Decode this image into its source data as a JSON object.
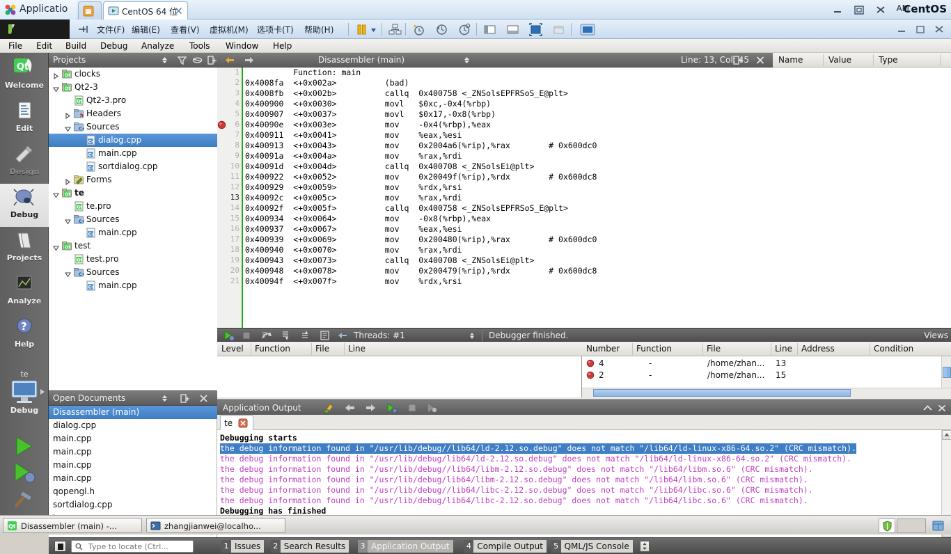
{
  "vmware": {
    "app_title": "Applicatio",
    "brand": "CentOS",
    "ram_label": "AM",
    "tabs": [
      {
        "label": "",
        "icon": "home-icon"
      },
      {
        "label": "CentOS 64 位",
        "icon": "vm-icon"
      }
    ],
    "menus": [
      {
        "label": "文件(F)"
      },
      {
        "label": "编辑(E)"
      },
      {
        "label": "查看(V)"
      },
      {
        "label": "虚拟机(M)"
      },
      {
        "label": "选项卡(T)"
      },
      {
        "label": "帮助(H)"
      }
    ],
    "toolbar_icons": [
      "pause-icon",
      "dropdown-arrow-icon",
      "snapshot-manager-icon",
      "take-snapshot-icon",
      "revert-snapshot-icon",
      "manage-snapshots-icon",
      "show-library-icon",
      "show-thumbnail-bar-icon",
      "fullscreen-icon",
      "unity-icon",
      "console-view-icon"
    ],
    "window_controls": [
      "minimize-icon",
      "restore-icon",
      "close-icon"
    ]
  },
  "qtcreator": {
    "menubar": [
      {
        "label": "File",
        "accel": "F"
      },
      {
        "label": "Edit",
        "accel": "E"
      },
      {
        "label": "Build",
        "accel": "u"
      },
      {
        "label": "Debug",
        "accel": "D"
      },
      {
        "label": "Analyze",
        "accel": "A"
      },
      {
        "label": "Tools",
        "accel": "T"
      },
      {
        "label": "Window",
        "accel": "W"
      },
      {
        "label": "Help",
        "accel": "H"
      }
    ],
    "modes": [
      {
        "label": "Welcome",
        "icon": "qt-logo-icon",
        "state": "normal"
      },
      {
        "label": "Edit",
        "icon": "document-icon",
        "state": "normal"
      },
      {
        "label": "Design",
        "icon": "design-tools-icon",
        "state": "disabled"
      },
      {
        "label": "Debug",
        "icon": "bug-icon",
        "state": "active"
      },
      {
        "label": "Projects",
        "icon": "folders-icon",
        "state": "normal"
      },
      {
        "label": "Analyze",
        "icon": "chart-icon",
        "state": "normal"
      },
      {
        "label": "Help",
        "icon": "question-mark-icon",
        "state": "normal"
      }
    ],
    "kit_selector": {
      "project": "te",
      "build_config": "Debug",
      "icon": "desktop-kit-icon"
    },
    "run_buttons": [
      "run-icon",
      "start-debugging-icon",
      "build-hammer-icon"
    ],
    "projects_panel": {
      "title": "Projects",
      "buttons": [
        "filter-icon",
        "link-with-editor-icon",
        "split-icon",
        "close-icon"
      ],
      "tree": [
        {
          "label": "clocks",
          "depth": 0,
          "arrow": "collapsed",
          "icon": "qt-project-icon",
          "bold": false,
          "selected": false
        },
        {
          "label": "Qt2-3",
          "depth": 0,
          "arrow": "expanded",
          "icon": "qt-project-icon",
          "bold": false,
          "selected": false
        },
        {
          "label": "Qt2-3.pro",
          "depth": 1,
          "arrow": "none",
          "icon": "pro-file-icon",
          "bold": false,
          "selected": false
        },
        {
          "label": "Headers",
          "depth": 1,
          "arrow": "collapsed",
          "icon": "headers-folder-icon",
          "bold": false,
          "selected": false
        },
        {
          "label": "Sources",
          "depth": 1,
          "arrow": "expanded",
          "icon": "sources-folder-icon",
          "bold": false,
          "selected": false
        },
        {
          "label": "dialog.cpp",
          "depth": 2,
          "arrow": "none",
          "icon": "cpp-file-icon",
          "bold": false,
          "selected": true
        },
        {
          "label": "main.cpp",
          "depth": 2,
          "arrow": "none",
          "icon": "cpp-file-icon",
          "bold": false,
          "selected": false
        },
        {
          "label": "sortdialog.cpp",
          "depth": 2,
          "arrow": "none",
          "icon": "cpp-file-icon",
          "bold": false,
          "selected": false
        },
        {
          "label": "Forms",
          "depth": 1,
          "arrow": "collapsed",
          "icon": "forms-folder-icon",
          "bold": false,
          "selected": false
        },
        {
          "label": "te",
          "depth": 0,
          "arrow": "expanded",
          "icon": "qt-project-icon",
          "bold": true,
          "selected": false
        },
        {
          "label": "te.pro",
          "depth": 1,
          "arrow": "none",
          "icon": "pro-file-icon",
          "bold": false,
          "selected": false
        },
        {
          "label": "Sources",
          "depth": 1,
          "arrow": "expanded",
          "icon": "sources-folder-icon",
          "bold": false,
          "selected": false
        },
        {
          "label": "main.cpp",
          "depth": 2,
          "arrow": "none",
          "icon": "cpp-file-icon",
          "bold": false,
          "selected": false
        },
        {
          "label": "test",
          "depth": 0,
          "arrow": "expanded",
          "icon": "qt-project-icon",
          "bold": false,
          "selected": false
        },
        {
          "label": "test.pro",
          "depth": 1,
          "arrow": "none",
          "icon": "pro-file-icon",
          "bold": false,
          "selected": false
        },
        {
          "label": "Sources",
          "depth": 1,
          "arrow": "expanded",
          "icon": "sources-folder-icon",
          "bold": false,
          "selected": false
        },
        {
          "label": "main.cpp",
          "depth": 2,
          "arrow": "none",
          "icon": "cpp-file-icon",
          "bold": false,
          "selected": false
        }
      ]
    },
    "open_documents": {
      "title": "Open Documents",
      "buttons": [
        "split-icon",
        "close-icon"
      ],
      "items": [
        {
          "label": "Disassembler (main)",
          "selected": true
        },
        {
          "label": "dialog.cpp",
          "selected": false
        },
        {
          "label": "main.cpp",
          "selected": false
        },
        {
          "label": "main.cpp",
          "selected": false
        },
        {
          "label": "main.cpp",
          "selected": false
        },
        {
          "label": "main.cpp",
          "selected": false
        },
        {
          "label": "qopengl.h",
          "selected": false
        },
        {
          "label": "sortdialog.cpp",
          "selected": false
        },
        {
          "label": "te.pro",
          "selected": false
        }
      ]
    },
    "editor": {
      "document_name": "Disassembler (main)",
      "line_col": "Line: 13, Col: 45",
      "nav_back_icon": "arrow-back-icon",
      "nav_forward_icon": "arrow-forward-icon",
      "split_icon": "split-icon",
      "close_icon": "close-icon",
      "current_line": 13,
      "breakpoint_line": 6,
      "lines": [
        {
          "n": 1,
          "text": "          Function: main"
        },
        {
          "n": 2,
          "text": "0x4008fa  <+0x002a>          (bad)"
        },
        {
          "n": 3,
          "text": "0x4008fb  <+0x002b>          callq  0x400758 <_ZNSolsEPFRSoS_E@plt>"
        },
        {
          "n": 4,
          "text": "0x400900  <+0x0030>          movl   $0xc,-0x4(%rbp)"
        },
        {
          "n": 5,
          "text": "0x400907  <+0x0037>          movl   $0x17,-0x8(%rbp)"
        },
        {
          "n": 6,
          "text": "0x40090e  <+0x003e>          mov    -0x4(%rbp),%eax"
        },
        {
          "n": 7,
          "text": "0x400911  <+0x0041>          mov    %eax,%esi"
        },
        {
          "n": 8,
          "text": "0x400913  <+0x0043>          mov    0x2004a6(%rip),%rax        # 0x600dc0"
        },
        {
          "n": 9,
          "text": "0x40091a  <+0x004a>          mov    %rax,%rdi"
        },
        {
          "n": 10,
          "text": "0x40091d  <+0x004d>          callq  0x400708 <_ZNSolsEi@plt>"
        },
        {
          "n": 11,
          "text": "0x400922  <+0x0052>          mov    0x20049f(%rip),%rdx        # 0x600dc8"
        },
        {
          "n": 12,
          "text": "0x400929  <+0x0059>          mov    %rdx,%rsi"
        },
        {
          "n": 13,
          "text": "0x40092c  <+0x005c>          mov    %rax,%rdi"
        },
        {
          "n": 14,
          "text": "0x40092f  <+0x005f>          callq  0x400758 <_ZNSolsEPFRSoS_E@plt>"
        },
        {
          "n": 15,
          "text": "0x400934  <+0x0064>          mov    -0x8(%rbp),%eax"
        },
        {
          "n": 16,
          "text": "0x400937  <+0x0067>          mov    %eax,%esi"
        },
        {
          "n": 17,
          "text": "0x400939  <+0x0069>          mov    0x200480(%rip),%rax        # 0x600dc0"
        },
        {
          "n": 18,
          "text": "0x400940  <+0x0070>          mov    %rax,%rdi"
        },
        {
          "n": 19,
          "text": "0x400943  <+0x0073>          callq  0x400708 <_ZNSolsEi@plt>"
        },
        {
          "n": 20,
          "text": "0x400948  <+0x0078>          mov    0x200479(%rip),%rdx        # 0x600dc8"
        },
        {
          "n": 21,
          "text": "0x40094f  <+0x007f>          mov    %rdx,%rsi"
        }
      ]
    },
    "locals_panel": {
      "columns": [
        "Name",
        "Value",
        "Type"
      ],
      "rows": []
    },
    "debug_toolbar": {
      "icons": [
        "continue-icon",
        "stop-icon",
        "step-over-icon",
        "step-into-icon",
        "step-out-icon",
        "instruction-mode-icon",
        "reverse-icon"
      ],
      "threads_label": "Threads: #1",
      "status": "Debugger finished.",
      "views_label": "Views"
    },
    "stack_view": {
      "columns": [
        "Level",
        "Function",
        "File",
        "Line"
      ],
      "rows": []
    },
    "breakpoints_view": {
      "columns": [
        "Number",
        "Function",
        "File",
        "Line",
        "Address",
        "Condition"
      ],
      "rows": [
        {
          "icon": "breakpoint-icon",
          "number": "4",
          "function": "-",
          "file": "/home/zhan...",
          "line": "13",
          "address": "",
          "condition": ""
        },
        {
          "icon": "breakpoint-icon",
          "number": "2",
          "function": "-",
          "file": "/home/zhan...",
          "line": "15",
          "address": "",
          "condition": ""
        }
      ]
    },
    "application_output": {
      "title": "Application Output",
      "toolbar_icons": [
        "clear-icon",
        "prev-item-icon",
        "next-item-icon",
        "run-icon",
        "stop-icon",
        "attach-icon"
      ],
      "minimize_icon": "chevron-up-icon",
      "close_icon": "close-icon",
      "tabs": [
        {
          "label": "te",
          "close_icon": "close-tab-icon"
        }
      ],
      "lines": [
        {
          "text": "Debugging starts",
          "style": "bold"
        },
        {
          "text": "the debug information found in \"/usr/lib/debug//lib64/ld-2.12.so.debug\" does not match \"/lib64/ld-linux-x86-64.so.2\" (CRC mismatch).",
          "style": "sel"
        },
        {
          "text": "the debug information found in \"/usr/lib/debug/lib64/ld-2.12.so.debug\" does not match \"/lib64/ld-linux-x86-64.so.2\" (CRC mismatch).",
          "style": "msg"
        },
        {
          "text": "the debug information found in \"/usr/lib/debug//lib64/libm-2.12.so.debug\" does not match \"/lib64/libm.so.6\" (CRC mismatch).",
          "style": "msg"
        },
        {
          "text": "the debug information found in \"/usr/lib/debug/lib64/libm-2.12.so.debug\" does not match \"/lib64/libm.so.6\" (CRC mismatch).",
          "style": "msg"
        },
        {
          "text": "the debug information found in \"/usr/lib/debug//lib64/libc-2.12.so.debug\" does not match \"/lib64/libc.so.6\" (CRC mismatch).",
          "style": "msg"
        },
        {
          "text": "the debug information found in \"/usr/lib/debug/lib64/libc-2.12.so.debug\" does not match \"/lib64/libc.so.6\" (CRC mismatch).",
          "style": "msg"
        },
        {
          "text": "Debugging has finished",
          "style": "bold"
        }
      ]
    },
    "statusbar": {
      "toggle_sidebar_icon": "toggle-sidebar-icon",
      "locate_placeholder": "Type to locate (Ctrl...",
      "search_icon": "search-icon",
      "panes": [
        {
          "num": "1",
          "label": "Issues",
          "active": false
        },
        {
          "num": "2",
          "label": "Search Results",
          "active": false
        },
        {
          "num": "3",
          "label": "Application Output",
          "active": true
        },
        {
          "num": "4",
          "label": "Compile Output",
          "active": false
        },
        {
          "num": "5",
          "label": "QML/JS Console",
          "active": false
        }
      ]
    }
  },
  "taskbar": {
    "items": [
      {
        "label": "Disassembler (main) -...",
        "icon": "qtcreator-icon"
      },
      {
        "label": "zhangjianwei@localho...",
        "icon": "terminal-icon"
      }
    ],
    "tray": [
      "shield-icon",
      "workspace-switcher-icon"
    ]
  },
  "colors": {
    "selection_blue": "#3f7ec4",
    "output_magenta": "#c040c0",
    "breakpoint_red": "#c83232",
    "current_line_green": "#1da81d"
  }
}
